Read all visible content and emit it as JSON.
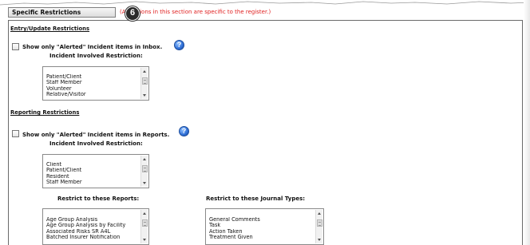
{
  "header": {
    "tab_label": "Specific Restrictions",
    "note": "(All options in this section are specific to the register.)",
    "callout_number": "6"
  },
  "entry_update": {
    "title": "Entry/Update Restrictions",
    "checkbox_label": "Show only \"Alerted\" Incident items in Inbox.",
    "checked": false,
    "help_icon": "help-icon",
    "restriction_label": "Incident Involved Restriction:",
    "options": [
      "Patient/Client",
      "Staff Member",
      "Volunteer",
      "Relative/Visitor"
    ]
  },
  "reporting": {
    "title": "Reporting Restrictions",
    "checkbox_label": "Show only \"Alerted\" Incident items in Reports.",
    "checked": false,
    "help_icon": "help-icon",
    "restriction_label": "Incident Involved Restriction:",
    "options": [
      "Client",
      "Patient/Client",
      "Resident",
      "Staff Member"
    ],
    "reports_label": "Restrict to these Reports:",
    "reports_options": [
      "Age Group Analysis",
      "Age Group Analysis by Facility",
      "Associated Risks SR A4L",
      "Batched Insurer Notification"
    ],
    "journal_label": "Restrict to these Journal Types:",
    "journal_options": [
      "General Comments",
      "Task",
      "Action Taken",
      "Treatment Given"
    ]
  },
  "colors": {
    "note_red": "#e02020",
    "panel_border": "#6a6a6a",
    "help_blue": "#2f6fd6"
  }
}
